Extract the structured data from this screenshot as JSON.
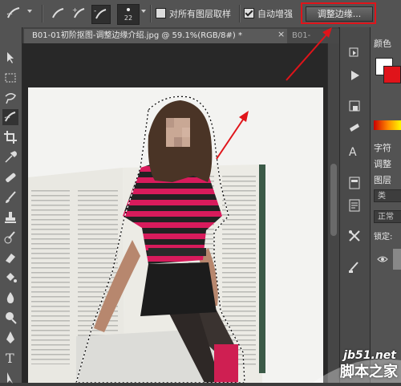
{
  "options_bar": {
    "brush_size": "22",
    "sample_all_layers_label": "对所有图层取样",
    "sample_all_layers_checked": false,
    "auto_enhance_label": "自动增强",
    "auto_enhance_checked": true,
    "refine_edge_label": "调整边缘..."
  },
  "tabs": [
    {
      "label": "B01-01初阶抠图-调整边缘介绍.jpg @ 59.1%(RGB/8#) *",
      "close": "×"
    },
    {
      "label": "B01-"
    }
  ],
  "right_panel": {
    "color_label": "颜色",
    "character_label": "字符",
    "adjust_label": "调整",
    "layers_label": "图层",
    "kind_label": "类",
    "blend_mode_label": "正常",
    "lock_label": "锁定:"
  },
  "watermark": {
    "site": "jb51.net",
    "name": "脚本之家"
  },
  "colors": {
    "annotation_red": "#e0141a",
    "panel_bg": "#535353",
    "stripe_pink": "#d81b5c"
  },
  "icons": {
    "quick_selection": "quick-selection-brush-icon",
    "move": "move-tool-icon",
    "marquee": "rectangular-marquee-icon",
    "lasso": "lasso-icon",
    "crop": "crop-icon",
    "eyedropper": "eyedropper-icon",
    "healing": "healing-brush-icon",
    "brush": "brush-icon",
    "stamp": "clone-stamp-icon",
    "history_brush": "history-brush-icon",
    "eraser": "eraser-icon",
    "gradient": "paint-bucket-icon",
    "blur": "blur-icon",
    "dodge": "dodge-icon",
    "pen": "pen-icon",
    "type": "type-icon"
  }
}
